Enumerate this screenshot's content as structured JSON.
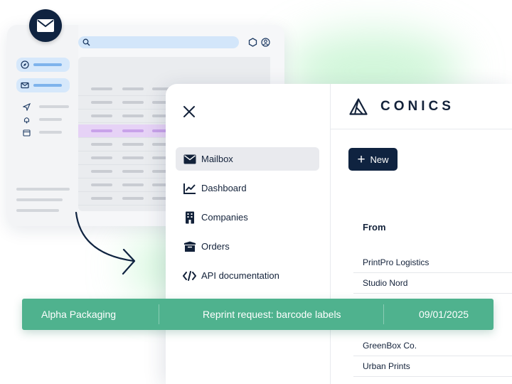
{
  "brand": {
    "name": "CONICS"
  },
  "menu": {
    "items": [
      {
        "label": "Mailbox",
        "icon": "mailbox-icon",
        "active": true
      },
      {
        "label": "Dashboard",
        "icon": "chart-line-icon",
        "active": false
      },
      {
        "label": "Companies",
        "icon": "building-icon",
        "active": false
      },
      {
        "label": "Orders",
        "icon": "box-icon",
        "active": false
      },
      {
        "label": "API documentation",
        "icon": "code-icon",
        "active": false
      }
    ]
  },
  "toolbar": {
    "new_label": "New"
  },
  "mailbox": {
    "column_from": "From",
    "rows": [
      {
        "from": "PrintPro Logistics"
      },
      {
        "from": "Studio Nord"
      },
      {
        "from": "GreenBox Co."
      },
      {
        "from": "Urban Prints"
      }
    ]
  },
  "highlighted_email": {
    "from": "Alpha Packaging",
    "subject": "Reprint request: barcode labels",
    "date": "09/01/2025"
  },
  "colors": {
    "navy": "#0f2340",
    "highlight_green": "#4fb28e",
    "active_item": "#e9eaee",
    "back_highlight_row": "#e6d2f6"
  }
}
